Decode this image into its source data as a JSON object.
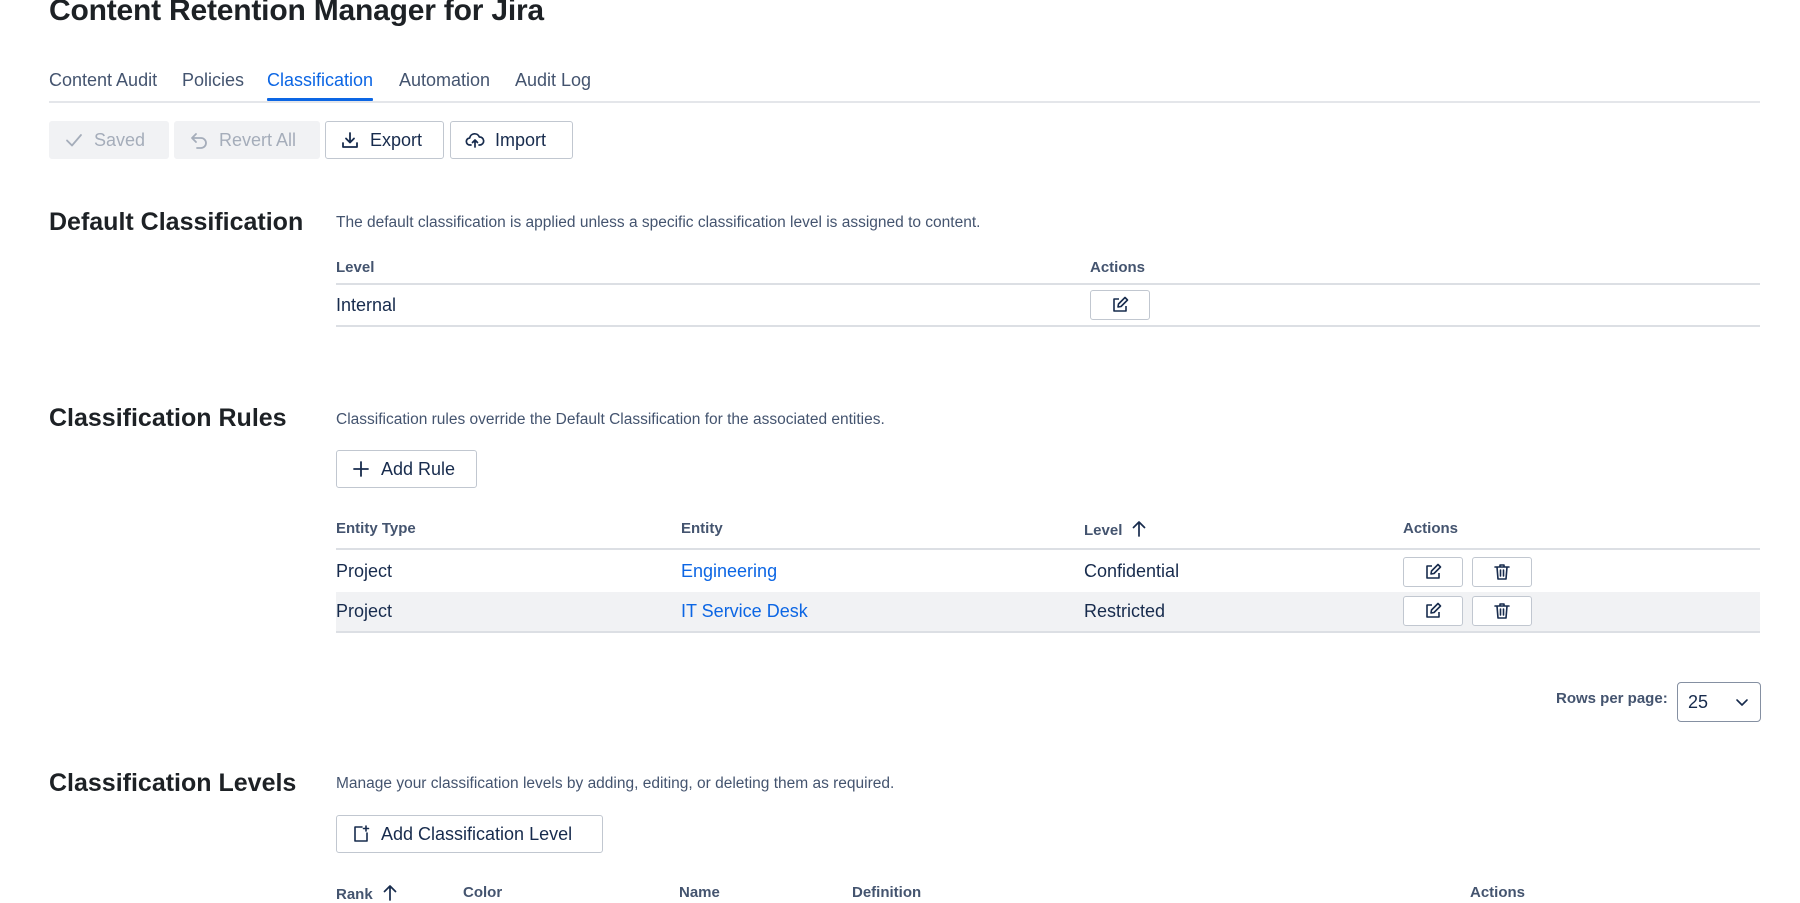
{
  "app": {
    "title": "Content Retention Manager for Jira"
  },
  "tabs": [
    {
      "label": "Content Audit",
      "active": false
    },
    {
      "label": "Policies",
      "active": false
    },
    {
      "label": "Classification",
      "active": true
    },
    {
      "label": "Automation",
      "active": false
    },
    {
      "label": "Audit Log",
      "active": false
    }
  ],
  "toolbar": {
    "saved_label": "Saved",
    "revert_label": "Revert All",
    "export_label": "Export",
    "import_label": "Import"
  },
  "default_classification": {
    "title": "Default Classification",
    "description": "The default classification is applied unless a specific classification level is assigned to content.",
    "columns": {
      "level": "Level",
      "actions": "Actions"
    },
    "row": {
      "level": "Internal"
    }
  },
  "classification_rules": {
    "title": "Classification Rules",
    "description": "Classification rules override the Default Classification for the associated entities.",
    "add_label": "Add Rule",
    "columns": {
      "entity_type": "Entity Type",
      "entity": "Entity",
      "level": "Level",
      "actions": "Actions"
    },
    "rows": [
      {
        "entity_type": "Project",
        "entity": "Engineering",
        "level": "Confidential"
      },
      {
        "entity_type": "Project",
        "entity": "IT Service Desk",
        "level": "Restricted"
      }
    ],
    "rows_per_page_label": "Rows per page:",
    "rows_per_page": "25"
  },
  "classification_levels": {
    "title": "Classification Levels",
    "description": "Manage your classification levels by adding, editing, or deleting them as required.",
    "add_label": "Add Classification Level",
    "columns": {
      "rank": "Rank",
      "color": "Color",
      "name": "Name",
      "definition": "Definition",
      "actions": "Actions"
    }
  },
  "colors": {
    "accent": "#0c66e4",
    "text": "#172b4d",
    "muted": "#44546f",
    "row_highlight": "#f1f2f4"
  },
  "icons": {
    "saved": "check-icon",
    "revert": "undo-icon",
    "export": "download-icon",
    "import": "upload-cloud-icon",
    "edit": "edit-icon",
    "delete": "trash-icon",
    "add": "plus-icon",
    "add_level": "add-page-icon",
    "sort": "arrow-up-icon",
    "select": "chevron-down-icon"
  }
}
